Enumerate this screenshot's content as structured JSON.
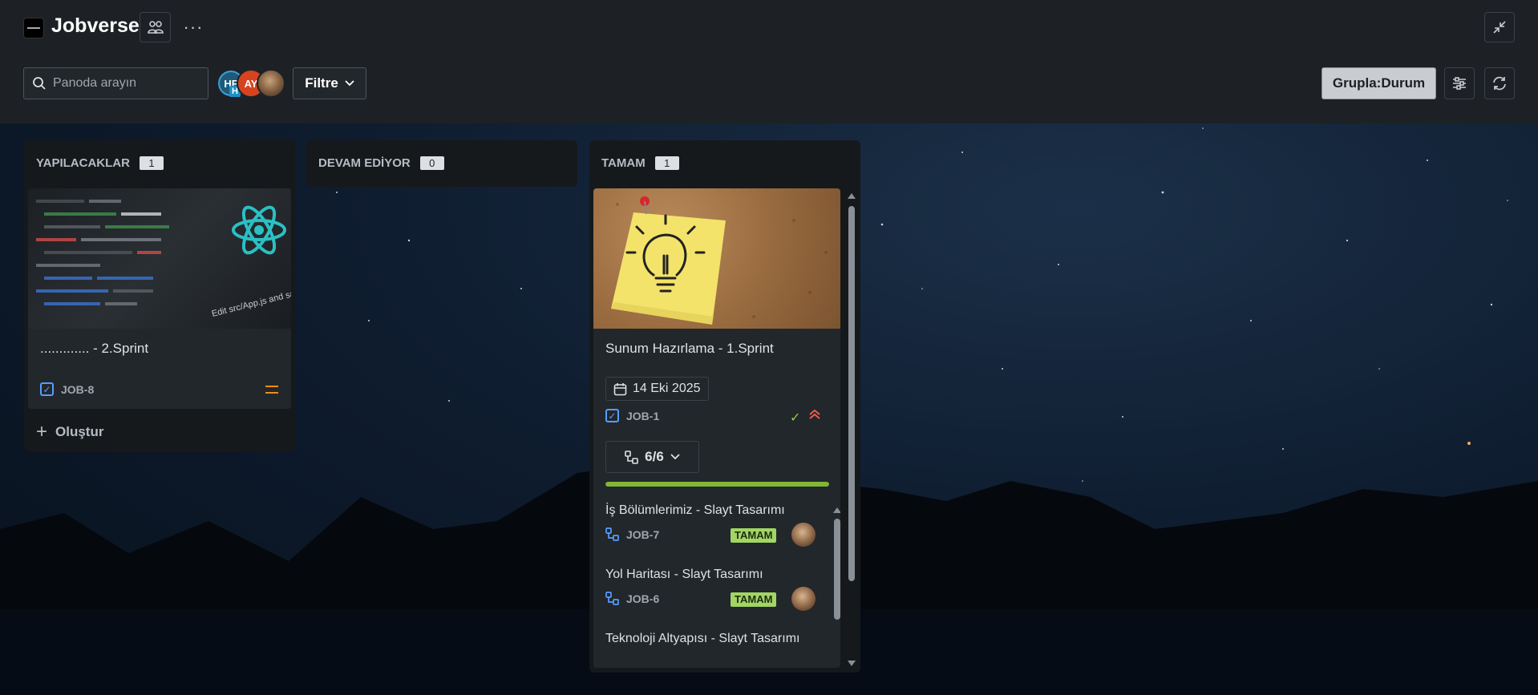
{
  "app": {
    "title": "Jobverse"
  },
  "toolbar": {
    "search_placeholder": "Panoda arayın",
    "filter_label": "Filtre",
    "group_label": "Grupla:Durum",
    "more_label": "···"
  },
  "avatars": [
    {
      "initials": "HF",
      "sub": "H",
      "color": "#1f5a7a"
    },
    {
      "initials": "AY",
      "color": "#d5431f"
    },
    {
      "initials": "",
      "kind": "photo"
    }
  ],
  "columns": [
    {
      "name": "YAPILACAKLAR",
      "count": "1",
      "cards": [
        {
          "title": "............. - 2.Sprint",
          "key": "JOB-8",
          "priority": "medium"
        }
      ],
      "create_label": "Oluştur"
    },
    {
      "name": "DEVAM EDİYOR",
      "count": "0",
      "cards": []
    },
    {
      "name": "TAMAM",
      "count": "1",
      "cards": [
        {
          "title": "Sunum Hazırlama - 1.Sprint",
          "due_date": "14 Eki 2025",
          "key": "JOB-1",
          "priority": "highest",
          "subtask_count": "6/6",
          "progress": 1.0,
          "subtasks": [
            {
              "title": "İş Bölümlerimiz - Slayt Tasarımı",
              "key": "JOB-7",
              "status": "TAMAM"
            },
            {
              "title": "Yol Haritası - Slayt Tasarımı",
              "key": "JOB-6",
              "status": "TAMAM"
            },
            {
              "title": "Teknoloji Altyapısı - Slayt Tasarımı",
              "key": "",
              "status": ""
            }
          ]
        }
      ]
    }
  ],
  "colors": {
    "header_bg": "#1d2125",
    "column_bg": "#16191c",
    "card_bg": "#22272b",
    "accent_blue": "#579dff",
    "done_green": "#a2d563",
    "priority_medium": "#f18d13",
    "priority_highest": "#f15b50"
  }
}
